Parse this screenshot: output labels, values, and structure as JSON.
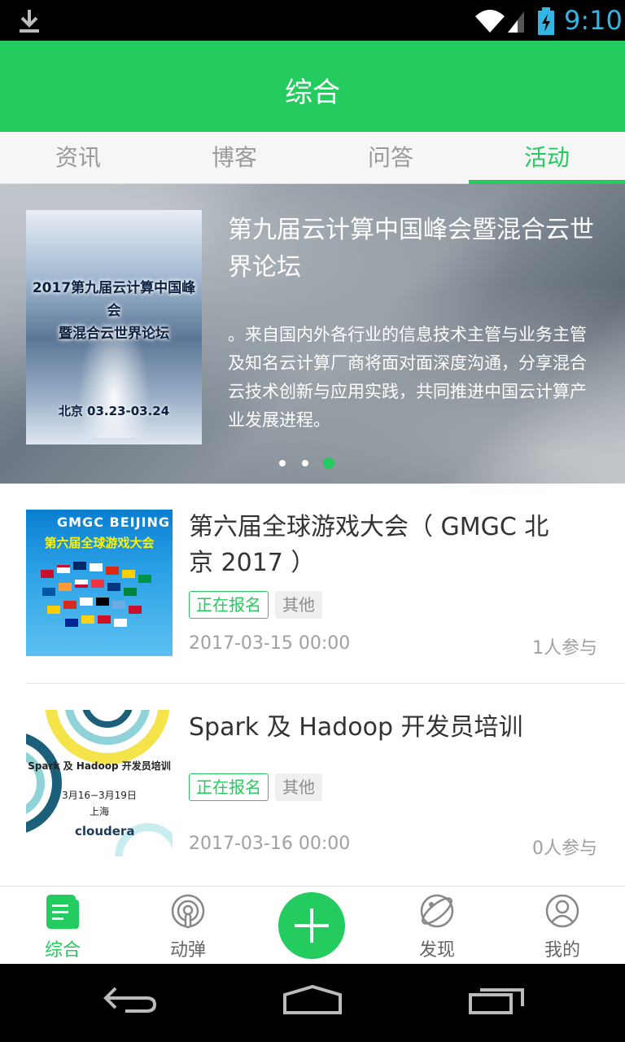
{
  "status_bar": {
    "time": "9:10",
    "icons": [
      "download-icon",
      "wifi-icon",
      "signal-icon",
      "battery-charging-icon"
    ]
  },
  "header": {
    "title": "综合"
  },
  "tabs": [
    {
      "label": "资讯",
      "active": false
    },
    {
      "label": "博客",
      "active": false
    },
    {
      "label": "问答",
      "active": false
    },
    {
      "label": "活动",
      "active": true
    }
  ],
  "banner": {
    "poster_title_line1": "2017第九届云计算中国峰会",
    "poster_title_line2": "暨混合云世界论坛",
    "poster_date": "北京 03.23-03.24",
    "title": "第九届云计算中国峰会暨混合云世界论坛",
    "description": "。来自国内外各行业的信息技术主管与业务主管及知名云计算厂商将面对面深度沟通，分享混合云技术创新与应用实践，共同推进中国云计算产业发展进程。",
    "dots": 3,
    "active_dot": 3
  },
  "events": [
    {
      "title": "第六届全球游戏大会（ GMGC 北京 2017 ）",
      "status": "正在报名",
      "category": "其他",
      "date": "2017-03-15 00:00",
      "participants": "1人参与",
      "thumb_logo": "GMGC BEIJING",
      "thumb_subtitle": "第六届全球游戏大会"
    },
    {
      "title": "Spark 及 Hadoop 开发员培训",
      "status": "正在报名",
      "category": "其他",
      "date": "2017-03-16 00:00",
      "participants": "0人参与",
      "thumb_title": "Spark 及 Hadoop 开发员培训",
      "thumb_dates": "3月16−3月19日",
      "thumb_city": "上海",
      "thumb_brand": "cloudera"
    }
  ],
  "bottom_nav": [
    {
      "label": "综合",
      "icon": "news-icon",
      "active": true
    },
    {
      "label": "动弹",
      "icon": "tweet-icon",
      "active": false
    },
    {
      "label": "",
      "icon": "plus-icon",
      "active": false
    },
    {
      "label": "发现",
      "icon": "discover-icon",
      "active": false
    },
    {
      "label": "我的",
      "icon": "profile-icon",
      "active": false
    }
  ],
  "colors": {
    "accent": "#24cb5f",
    "status_bar_text": "#33b5e5"
  }
}
